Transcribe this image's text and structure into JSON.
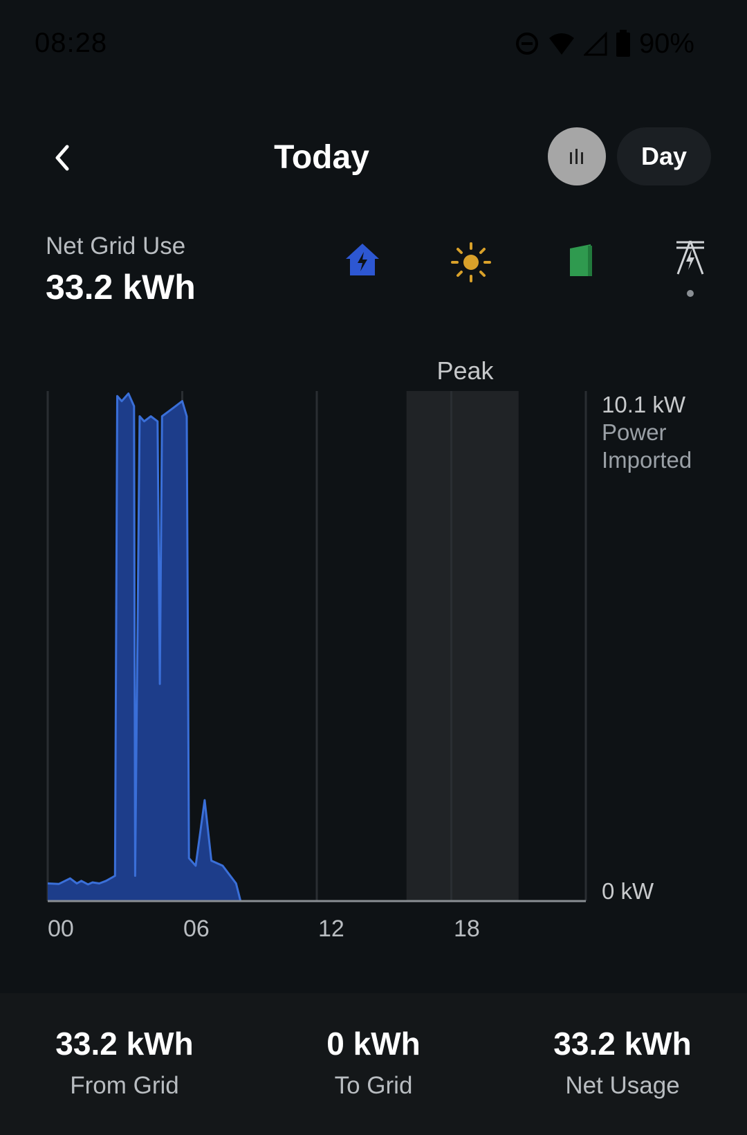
{
  "status_bar": {
    "time": "08:28",
    "battery": "90%"
  },
  "header": {
    "title": "Today",
    "period": "Day"
  },
  "summary": {
    "label": "Net Grid Use",
    "value": "33.2 kWh"
  },
  "source_icons": [
    "home-icon",
    "solar-icon",
    "battery-icon",
    "grid-tower-icon"
  ],
  "chart_data": {
    "type": "area",
    "x": [
      0,
      0.5,
      1.0,
      1.3,
      1.5,
      1.8,
      2.0,
      2.3,
      2.6,
      3.0,
      3.1,
      3.3,
      3.6,
      3.85,
      3.9,
      4.1,
      4.3,
      4.6,
      4.9,
      5.0,
      5.1,
      5.4,
      5.7,
      6.0,
      6.2,
      6.3,
      6.6,
      7.0,
      7.3,
      7.8,
      8.4,
      8.6,
      9,
      12,
      15,
      18,
      21,
      24
    ],
    "y": [
      0.35,
      0.34,
      0.45,
      0.35,
      0.4,
      0.33,
      0.37,
      0.35,
      0.4,
      0.5,
      10.0,
      9.9,
      10.05,
      9.8,
      0.5,
      9.6,
      9.5,
      9.6,
      9.5,
      4.3,
      9.6,
      9.7,
      9.8,
      9.9,
      9.6,
      0.85,
      0.7,
      2.0,
      0.8,
      0.7,
      0.35,
      0.0,
      0.0,
      0.0,
      0.0,
      0.0,
      0.0,
      0.0
    ],
    "x_ticks": [
      "00",
      "06",
      "12",
      "18"
    ],
    "xlim": [
      0,
      24
    ],
    "ylim": [
      0,
      10.1
    ],
    "y_max_label": "10.1 kW",
    "y_min_label": "0 kW",
    "y_label_line1": "Power",
    "y_label_line2": "Imported",
    "peak_label": "Peak",
    "peak_range": [
      16,
      21
    ],
    "series_color": "#3a6fd8",
    "fill_color": "#1d3d8a"
  },
  "stats": [
    {
      "value": "33.2 kWh",
      "label": "From Grid"
    },
    {
      "value": "0 kWh",
      "label": "To Grid"
    },
    {
      "value": "33.2 kWh",
      "label": "Net Usage"
    }
  ]
}
